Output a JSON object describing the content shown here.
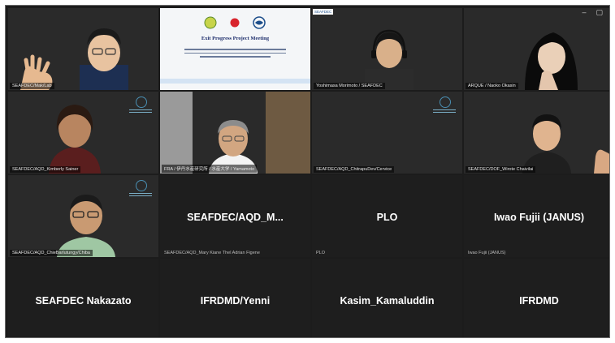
{
  "window": {
    "minimize_icon": "minimize-icon",
    "maximize_icon": "maximize-icon"
  },
  "tiles": [
    {
      "name": "SEAFDEC/Mak/Lab",
      "kind": "video"
    },
    {
      "name": "",
      "kind": "slide"
    },
    {
      "name": "Yoshimasa Morimoto / SEAFDEC",
      "kind": "video"
    },
    {
      "name": "ARQUE / Naoko Okasin",
      "kind": "video"
    },
    {
      "name": "SEAFDEC/AQD_Kimberly Sainer",
      "kind": "video"
    },
    {
      "name": "FRA / 伊丹水産研究所 / 水産大学 / Yamamoto",
      "kind": "video"
    },
    {
      "name": "SEAFDEC/AQD_ChitrapuDev/Cervice",
      "kind": "video"
    },
    {
      "name": "SEAFDEC/DOF_Wirote Chaivilai",
      "kind": "video"
    },
    {
      "name": "SEAFDEC/AQD_ChieBarlutungy/Chiba",
      "kind": "video"
    },
    {
      "name": "SEAFDEC/AQD_Mary Kiane Thel Adrian Figene",
      "big": "SEAFDEC/AQD_M...",
      "kind": "empty"
    },
    {
      "name": "PLO",
      "big": "PLO",
      "kind": "empty"
    },
    {
      "name": "Iwao Fujii (JANUS)",
      "big": "Iwao Fujii (JANUS)",
      "kind": "empty"
    },
    {
      "name": "",
      "big": "SEAFDEC Nakazato",
      "kind": "empty"
    },
    {
      "name": "",
      "big": "IFRDMD/Yenni",
      "kind": "empty"
    },
    {
      "name": "",
      "big": "Kasim_Kamaluddin",
      "kind": "empty"
    },
    {
      "name": "",
      "big": "IFRDMD",
      "kind": "empty"
    }
  ],
  "slide": {
    "title": "Exit Progress Project Meeting",
    "org_badge": "SEAFDEC"
  }
}
